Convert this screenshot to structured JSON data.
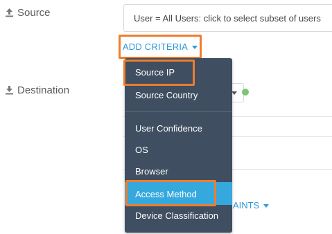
{
  "form": {
    "source_label": "Source",
    "source_value": "User = All Users: click to select subset of users",
    "destination_label": "Destination",
    "add_criteria_label": "ADD CRITERIA",
    "bg_small_text": "TS",
    "bg_blue_text": "AINTS"
  },
  "menu": {
    "items": [
      {
        "label": "Source IP"
      },
      {
        "label": "Source Country"
      },
      {
        "label": "User Confidence"
      },
      {
        "label": "OS"
      },
      {
        "label": "Browser"
      },
      {
        "label": "Access Method"
      },
      {
        "label": "Device Classification"
      }
    ]
  },
  "colors": {
    "menu_bg": "#3f4e60",
    "highlight_orange": "#ef7d2e",
    "link_blue": "#2d9ad6",
    "selected_item_bg": "#35a9de",
    "status_green": "#7cc576"
  },
  "icons": {
    "source": "upload-icon",
    "destination": "download-icon"
  }
}
